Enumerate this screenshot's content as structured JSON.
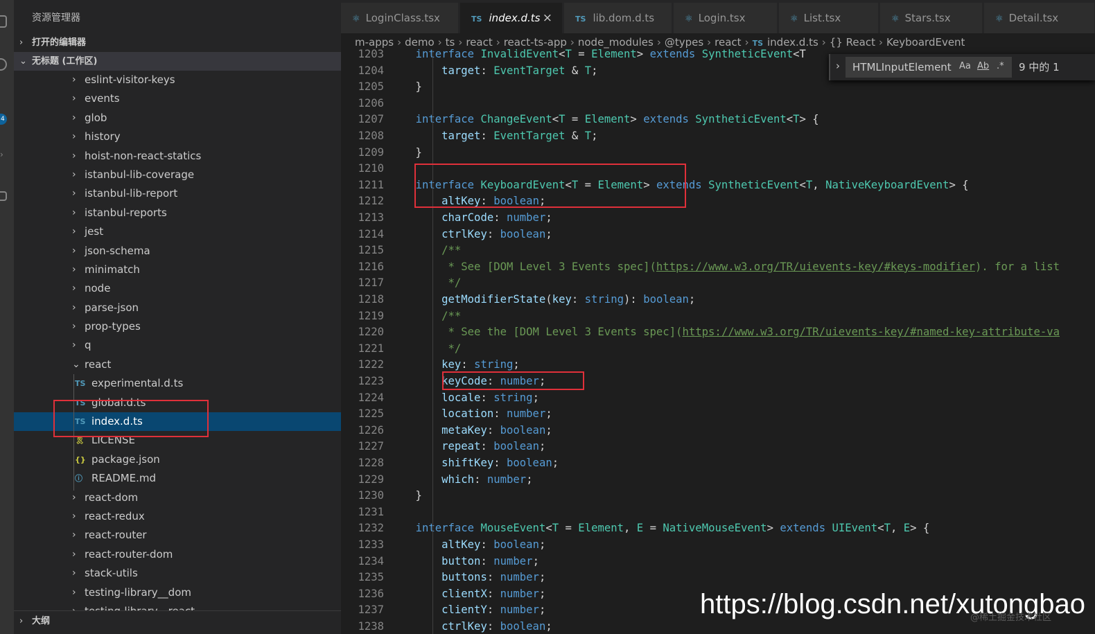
{
  "sidebar": {
    "title": "资源管理器",
    "open_editors": "打开的编辑器",
    "workspace": "无标题 (工作区)",
    "outline": "大纲",
    "activity_badge": "4",
    "folders_top": [
      "eslint-visitor-keys",
      "events",
      "glob",
      "history",
      "hoist-non-react-statics",
      "istanbul-lib-coverage",
      "istanbul-lib-report",
      "istanbul-reports",
      "jest",
      "json-schema",
      "minimatch",
      "node",
      "parse-json",
      "prop-types",
      "q"
    ],
    "react_folder": "react",
    "react_files": [
      {
        "icon": "TS",
        "name": "experimental.d.ts",
        "color": "#519aba"
      },
      {
        "icon": "TS",
        "name": "global.d.ts",
        "color": "#519aba"
      },
      {
        "icon": "TS",
        "name": "index.d.ts",
        "color": "#519aba"
      },
      {
        "icon": "🎗",
        "name": "LICENSE",
        "color": "#cbcb41"
      },
      {
        "icon": "{}",
        "name": "package.json",
        "color": "#cbcb41"
      },
      {
        "icon": "ⓘ",
        "name": "README.md",
        "color": "#519aba"
      }
    ],
    "folders_bottom": [
      "react-dom",
      "react-redux",
      "react-router",
      "react-router-dom",
      "stack-utils",
      "testing-library__dom",
      "testing-library__react"
    ]
  },
  "tabs": [
    {
      "name": "LoginClass.tsx",
      "icon": "⚛",
      "active": false
    },
    {
      "name": "index.d.ts",
      "icon": "TS",
      "active": true
    },
    {
      "name": "lib.dom.d.ts",
      "icon": "TS",
      "active": false
    },
    {
      "name": "Login.tsx",
      "icon": "⚛",
      "active": false
    },
    {
      "name": "List.tsx",
      "icon": "⚛",
      "active": false
    },
    {
      "name": "Stars.tsx",
      "icon": "⚛",
      "active": false
    },
    {
      "name": "Detail.tsx",
      "icon": "⚛",
      "active": false
    }
  ],
  "breadcrumbs": [
    "m-apps",
    "demo",
    "ts",
    "react",
    "react-ts-app",
    "node_modules",
    "@types",
    "react",
    "index.d.ts",
    "{} React",
    "KeyboardEvent"
  ],
  "find": {
    "query": "HTMLInputElement",
    "case_label": "Aa",
    "word_label": "Ab",
    "regex_label": ".*",
    "count": "9 中的 1"
  },
  "code_lines": [
    {
      "n": "1203",
      "t": [
        [
          "    ",
          "op"
        ],
        [
          "interface ",
          "kw"
        ],
        [
          "InvalidEvent",
          "ty"
        ],
        [
          "<",
          "op"
        ],
        [
          "T",
          "ty"
        ],
        [
          " = ",
          "op"
        ],
        [
          "Element",
          "ty"
        ],
        [
          "> ",
          "op"
        ],
        [
          "extends ",
          "kw"
        ],
        [
          "SyntheticEvent",
          "ty"
        ],
        [
          "<T",
          "op"
        ]
      ]
    },
    {
      "n": "1204",
      "t": [
        [
          "        ",
          "op"
        ],
        [
          "target",
          "pr"
        ],
        [
          ": ",
          "op"
        ],
        [
          "EventTarget",
          "ty"
        ],
        [
          " & ",
          "op"
        ],
        [
          "T",
          "ty"
        ],
        [
          ";",
          "op"
        ]
      ]
    },
    {
      "n": "1205",
      "t": [
        [
          "    }",
          "op"
        ]
      ]
    },
    {
      "n": "1206",
      "t": [
        [
          "",
          "op"
        ]
      ]
    },
    {
      "n": "1207",
      "t": [
        [
          "    ",
          "op"
        ],
        [
          "interface ",
          "kw"
        ],
        [
          "ChangeEvent",
          "ty"
        ],
        [
          "<",
          "op"
        ],
        [
          "T",
          "ty"
        ],
        [
          " = ",
          "op"
        ],
        [
          "Element",
          "ty"
        ],
        [
          "> ",
          "op"
        ],
        [
          "extends ",
          "kw"
        ],
        [
          "SyntheticEvent",
          "ty"
        ],
        [
          "<",
          "op"
        ],
        [
          "T",
          "ty"
        ],
        [
          "> {",
          "op"
        ]
      ]
    },
    {
      "n": "1208",
      "t": [
        [
          "        ",
          "op"
        ],
        [
          "target",
          "pr"
        ],
        [
          ": ",
          "op"
        ],
        [
          "EventTarget",
          "ty"
        ],
        [
          " & ",
          "op"
        ],
        [
          "T",
          "ty"
        ],
        [
          ";",
          "op"
        ]
      ]
    },
    {
      "n": "1209",
      "t": [
        [
          "    }",
          "op"
        ]
      ]
    },
    {
      "n": "1210",
      "t": [
        [
          "",
          "op"
        ]
      ]
    },
    {
      "n": "1211",
      "t": [
        [
          "    ",
          "op"
        ],
        [
          "interface ",
          "kw"
        ],
        [
          "KeyboardEvent",
          "ty"
        ],
        [
          "<",
          "op"
        ],
        [
          "T",
          "ty"
        ],
        [
          " = ",
          "op"
        ],
        [
          "Element",
          "ty"
        ],
        [
          "> ",
          "op"
        ],
        [
          "extends ",
          "kw"
        ],
        [
          "SyntheticEvent",
          "ty"
        ],
        [
          "<",
          "op"
        ],
        [
          "T",
          "ty"
        ],
        [
          ", ",
          "op"
        ],
        [
          "NativeKeyboardEvent",
          "ty"
        ],
        [
          "> {",
          "op"
        ]
      ]
    },
    {
      "n": "1212",
      "t": [
        [
          "        ",
          "op"
        ],
        [
          "altKey",
          "pr"
        ],
        [
          ": ",
          "op"
        ],
        [
          "boolean",
          "kw"
        ],
        [
          ";",
          "op"
        ]
      ]
    },
    {
      "n": "1213",
      "t": [
        [
          "        ",
          "op"
        ],
        [
          "charCode",
          "pr"
        ],
        [
          ": ",
          "op"
        ],
        [
          "number",
          "kw"
        ],
        [
          ";",
          "op"
        ]
      ]
    },
    {
      "n": "1214",
      "t": [
        [
          "        ",
          "op"
        ],
        [
          "ctrlKey",
          "pr"
        ],
        [
          ": ",
          "op"
        ],
        [
          "boolean",
          "kw"
        ],
        [
          ";",
          "op"
        ]
      ]
    },
    {
      "n": "1215",
      "t": [
        [
          "        /**",
          "cm"
        ]
      ]
    },
    {
      "n": "1216",
      "t": [
        [
          "         * See [DOM Level 3 Events spec](",
          "cm"
        ],
        [
          "https://www.w3.org/TR/uievents-key/#keys-modifier",
          "lk"
        ],
        [
          "). for a list",
          "cm"
        ]
      ]
    },
    {
      "n": "1217",
      "t": [
        [
          "         */",
          "cm"
        ]
      ]
    },
    {
      "n": "1218",
      "t": [
        [
          "        ",
          "op"
        ],
        [
          "getModifierState",
          "pr"
        ],
        [
          "(",
          "op"
        ],
        [
          "key",
          "pr"
        ],
        [
          ": ",
          "op"
        ],
        [
          "string",
          "kw"
        ],
        [
          "): ",
          "op"
        ],
        [
          "boolean",
          "kw"
        ],
        [
          ";",
          "op"
        ]
      ]
    },
    {
      "n": "1219",
      "t": [
        [
          "        /**",
          "cm"
        ]
      ]
    },
    {
      "n": "1220",
      "t": [
        [
          "         * See the [DOM Level 3 Events spec](",
          "cm"
        ],
        [
          "https://www.w3.org/TR/uievents-key/#named-key-attribute-va",
          "lk"
        ]
      ]
    },
    {
      "n": "1221",
      "t": [
        [
          "         */",
          "cm"
        ]
      ]
    },
    {
      "n": "1222",
      "t": [
        [
          "        ",
          "op"
        ],
        [
          "key",
          "pr"
        ],
        [
          ": ",
          "op"
        ],
        [
          "string",
          "kw"
        ],
        [
          ";",
          "op"
        ]
      ]
    },
    {
      "n": "1223",
      "t": [
        [
          "        ",
          "op"
        ],
        [
          "keyCode",
          "pr"
        ],
        [
          ": ",
          "op"
        ],
        [
          "number",
          "kw"
        ],
        [
          ";",
          "op"
        ]
      ]
    },
    {
      "n": "1224",
      "t": [
        [
          "        ",
          "op"
        ],
        [
          "locale",
          "pr"
        ],
        [
          ": ",
          "op"
        ],
        [
          "string",
          "kw"
        ],
        [
          ";",
          "op"
        ]
      ]
    },
    {
      "n": "1225",
      "t": [
        [
          "        ",
          "op"
        ],
        [
          "location",
          "pr"
        ],
        [
          ": ",
          "op"
        ],
        [
          "number",
          "kw"
        ],
        [
          ";",
          "op"
        ]
      ]
    },
    {
      "n": "1226",
      "t": [
        [
          "        ",
          "op"
        ],
        [
          "metaKey",
          "pr"
        ],
        [
          ": ",
          "op"
        ],
        [
          "boolean",
          "kw"
        ],
        [
          ";",
          "op"
        ]
      ]
    },
    {
      "n": "1227",
      "t": [
        [
          "        ",
          "op"
        ],
        [
          "repeat",
          "pr"
        ],
        [
          ": ",
          "op"
        ],
        [
          "boolean",
          "kw"
        ],
        [
          ";",
          "op"
        ]
      ]
    },
    {
      "n": "1228",
      "t": [
        [
          "        ",
          "op"
        ],
        [
          "shiftKey",
          "pr"
        ],
        [
          ": ",
          "op"
        ],
        [
          "boolean",
          "kw"
        ],
        [
          ";",
          "op"
        ]
      ]
    },
    {
      "n": "1229",
      "t": [
        [
          "        ",
          "op"
        ],
        [
          "which",
          "pr"
        ],
        [
          ": ",
          "op"
        ],
        [
          "number",
          "kw"
        ],
        [
          ";",
          "op"
        ]
      ]
    },
    {
      "n": "1230",
      "t": [
        [
          "    }",
          "op"
        ]
      ]
    },
    {
      "n": "1231",
      "t": [
        [
          "",
          "op"
        ]
      ]
    },
    {
      "n": "1232",
      "t": [
        [
          "    ",
          "op"
        ],
        [
          "interface ",
          "kw"
        ],
        [
          "MouseEvent",
          "ty"
        ],
        [
          "<",
          "op"
        ],
        [
          "T",
          "ty"
        ],
        [
          " = ",
          "op"
        ],
        [
          "Element",
          "ty"
        ],
        [
          ", ",
          "op"
        ],
        [
          "E",
          "ty"
        ],
        [
          " = ",
          "op"
        ],
        [
          "NativeMouseEvent",
          "ty"
        ],
        [
          "> ",
          "op"
        ],
        [
          "extends ",
          "kw"
        ],
        [
          "UIEvent",
          "ty"
        ],
        [
          "<",
          "op"
        ],
        [
          "T",
          "ty"
        ],
        [
          ", ",
          "op"
        ],
        [
          "E",
          "ty"
        ],
        [
          "> {",
          "op"
        ]
      ]
    },
    {
      "n": "1233",
      "t": [
        [
          "        ",
          "op"
        ],
        [
          "altKey",
          "pr"
        ],
        [
          ": ",
          "op"
        ],
        [
          "boolean",
          "kw"
        ],
        [
          ";",
          "op"
        ]
      ]
    },
    {
      "n": "1234",
      "t": [
        [
          "        ",
          "op"
        ],
        [
          "button",
          "pr"
        ],
        [
          ": ",
          "op"
        ],
        [
          "number",
          "kw"
        ],
        [
          ";",
          "op"
        ]
      ]
    },
    {
      "n": "1235",
      "t": [
        [
          "        ",
          "op"
        ],
        [
          "buttons",
          "pr"
        ],
        [
          ": ",
          "op"
        ],
        [
          "number",
          "kw"
        ],
        [
          ";",
          "op"
        ]
      ]
    },
    {
      "n": "1236",
      "t": [
        [
          "        ",
          "op"
        ],
        [
          "clientX",
          "pr"
        ],
        [
          ": ",
          "op"
        ],
        [
          "number",
          "kw"
        ],
        [
          ";",
          "op"
        ]
      ]
    },
    {
      "n": "1237",
      "t": [
        [
          "        ",
          "op"
        ],
        [
          "clientY",
          "pr"
        ],
        [
          ": ",
          "op"
        ],
        [
          "number",
          "kw"
        ],
        [
          ";",
          "op"
        ]
      ]
    },
    {
      "n": "1238",
      "t": [
        [
          "        ",
          "op"
        ],
        [
          "ctrlKey",
          "pr"
        ],
        [
          ": ",
          "op"
        ],
        [
          "boolean",
          "kw"
        ],
        [
          ";",
          "op"
        ]
      ]
    }
  ],
  "watermark": "https://blog.csdn.net/xutongbao",
  "watermark_small": "@稀土掘金技术社区"
}
